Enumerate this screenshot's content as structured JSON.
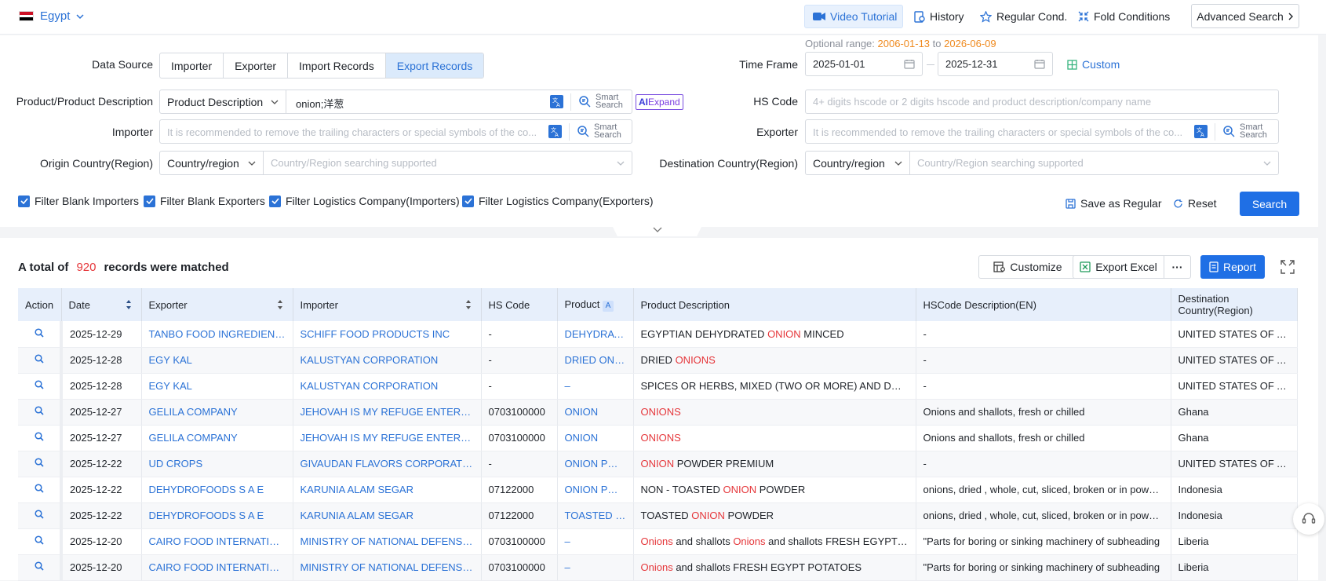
{
  "topbar": {
    "country": "Egypt",
    "flag_colors": [
      "#ce1126",
      "#ffffff",
      "#000000"
    ],
    "video_tutorial": "Video Tutorial",
    "history": "History",
    "regular_cond": "Regular Cond.",
    "fold_conditions": "Fold Conditions",
    "advanced_search": "Advanced Search"
  },
  "filters": {
    "optional_range_label": "Optional range:",
    "range_start": "2006-01-13",
    "range_to": "to",
    "range_end": "2026-06-09",
    "data_source_label": "Data Source",
    "data_source_tabs": [
      "Importer",
      "Exporter",
      "Import Records",
      "Export Records"
    ],
    "data_source_active": "Export Records",
    "time_frame_label": "Time Frame",
    "date_from": "2025-01-01",
    "date_to": "2025-12-31",
    "custom": "Custom",
    "product_label": "Product/Product Description",
    "product_type": "Product Description",
    "product_value": "onion;洋葱",
    "smart_search_1": "Smart",
    "smart_search_2": "Search",
    "ai_prefix": "AI",
    "ai_expand": "Expand",
    "hs_label": "HS Code",
    "hs_placeholder": "4+ digits hscode or 2 digits hscode and product description/company name",
    "importer_label": "Importer",
    "importer_placeholder": "It is recommended to remove the trailing characters or special symbols of the co...",
    "exporter_label": "Exporter",
    "exporter_placeholder": "It is recommended to remove the trailing characters or special symbols of the co...",
    "origin_label": "Origin Country(Region)",
    "country_select": "Country/region",
    "country_placeholder": "Country/Region searching supported",
    "destination_label": "Destination Country(Region)",
    "checks": [
      "Filter Blank Importers",
      "Filter Blank Exporters",
      "Filter Logistics Company(Importers)",
      "Filter Logistics Company(Exporters)"
    ],
    "save_regular": "Save as Regular",
    "reset": "Reset",
    "search": "Search"
  },
  "results": {
    "total_prefix": "A total of",
    "total_count": "920",
    "total_suffix": "records were matched",
    "customize": "Customize",
    "export_excel": "Export Excel",
    "more": "···",
    "report": "Report",
    "columns": [
      "Action",
      "Date",
      "Exporter",
      "Importer",
      "HS Code",
      "Product",
      "Product Description",
      "HSCode Description(EN)",
      "Destination Country(Region)"
    ],
    "product_col_ai": "A",
    "rows": [
      {
        "date": "2025-12-29",
        "exporter": "TANBO FOOD INGREDIENTS ...",
        "importer": "SCHIFF FOOD PRODUCTS INC",
        "hs": "-",
        "product": "DEHYDRATED ONION",
        "desc": [
          [
            "EGYPTIAN DEHYDRATED ",
            false
          ],
          [
            "ONION",
            true
          ],
          [
            " MINCED",
            false
          ]
        ],
        "hsdesc": "-",
        "dest": "UNITED STATES OF AMERICA"
      },
      {
        "date": "2025-12-28",
        "exporter": "EGY KAL",
        "importer": "KALUSTYAN CORPORATION",
        "hs": "-",
        "product": "DRIED ONIONS",
        "desc": [
          [
            "DRIED ",
            false
          ],
          [
            "ONIONS",
            true
          ]
        ],
        "hsdesc": "-",
        "dest": "UNITED STATES OF AMERICA"
      },
      {
        "date": "2025-12-28",
        "exporter": "EGY KAL",
        "importer": "KALUSTYAN CORPORATION",
        "hs": "-",
        "product": "–",
        "desc": [
          [
            "SPICES OR HERBS, MIXED (TWO OR MORE) AND DRIE D ONIONS",
            false
          ]
        ],
        "hsdesc": "-",
        "dest": "UNITED STATES OF AMERICA"
      },
      {
        "date": "2025-12-27",
        "exporter": "GELILA COMPANY",
        "importer": "JEHOVAH IS MY REFUGE ENTERPRISES",
        "hs": "0703100000",
        "product": "ONION",
        "desc": [
          [
            "ONIONS",
            true
          ]
        ],
        "hsdesc": "Onions and shallots, fresh or chilled",
        "dest": "Ghana"
      },
      {
        "date": "2025-12-27",
        "exporter": "GELILA COMPANY",
        "importer": "JEHOVAH IS MY REFUGE ENTERPRISES",
        "hs": "0703100000",
        "product": "ONION",
        "desc": [
          [
            "ONIONS",
            true
          ]
        ],
        "hsdesc": "Onions and shallots, fresh or chilled",
        "dest": "Ghana"
      },
      {
        "date": "2025-12-22",
        "exporter": "UD CROPS",
        "importer": "GIVAUDAN FLAVORS CORPORATION",
        "hs": "-",
        "product": "ONION POWDER",
        "desc": [
          [
            "ONION",
            true
          ],
          [
            " POWDER PREMIUM",
            false
          ]
        ],
        "hsdesc": "-",
        "dest": "UNITED STATES OF AMERICA"
      },
      {
        "date": "2025-12-22",
        "exporter": "DEHYDROFOODS S A E",
        "importer": "KARUNIA ALAM SEGAR",
        "hs": "07122000",
        "product": "ONION POWDER",
        "desc": [
          [
            "NON - TOASTED ",
            false
          ],
          [
            "ONION",
            true
          ],
          [
            " POWDER",
            false
          ]
        ],
        "hsdesc": "onions, dried , whole, cut, sliced, broken or in powder",
        "dest": "Indonesia"
      },
      {
        "date": "2025-12-22",
        "exporter": "DEHYDROFOODS S A E",
        "importer": "KARUNIA ALAM SEGAR",
        "hs": "07122000",
        "product": "TOASTED ONION",
        "desc": [
          [
            "TOASTED ",
            false
          ],
          [
            "ONION",
            true
          ],
          [
            " POWDER",
            false
          ]
        ],
        "hsdesc": "onions, dried , whole, cut, sliced, broken or in powder",
        "dest": "Indonesia"
      },
      {
        "date": "2025-12-20",
        "exporter": "CAIRO FOOD INTERNATIONAL ...",
        "importer": "MINISTRY OF NATIONAL DEFENSE ...",
        "hs": "0703100000",
        "product": "–",
        "desc": [
          [
            "Onions",
            true
          ],
          [
            " and shallots ",
            false
          ],
          [
            "Onions",
            true
          ],
          [
            " and shallots FRESH EGYPT ONIONS",
            false
          ]
        ],
        "hsdesc": "\"Parts for boring or sinking machinery of subheading",
        "dest": "Liberia"
      },
      {
        "date": "2025-12-20",
        "exporter": "CAIRO FOOD INTERNATIONAL ...",
        "importer": "MINISTRY OF NATIONAL DEFENSE ...",
        "hs": "0703100000",
        "product": "–",
        "desc": [
          [
            "Onions",
            true
          ],
          [
            " and shallots FRESH EGYPT POTATOES",
            false
          ]
        ],
        "hsdesc": "\"Parts for boring or sinking machinery of subheading",
        "dest": "Liberia"
      }
    ]
  }
}
